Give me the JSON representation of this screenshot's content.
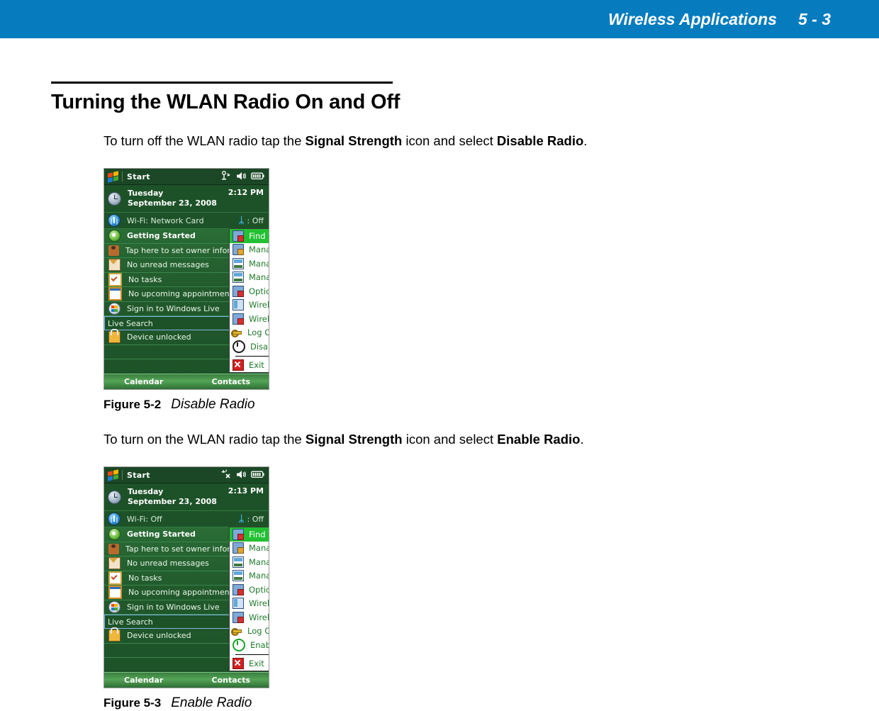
{
  "header": {
    "title": "Wireless Applications",
    "page_number": "5 - 3",
    "band_color": "#067cbf"
  },
  "section": {
    "heading": "Turning the WLAN Radio On and Off"
  },
  "paragraphs": {
    "p1": {
      "part1": "To turn off the WLAN radio tap the ",
      "bold1": "Signal Strength",
      "part2": " icon and select ",
      "bold2": "Disable Radio",
      "part3": "."
    },
    "p2": {
      "part1": "To turn on the WLAN radio tap the ",
      "bold1": "Signal Strength",
      "part2": " icon and select ",
      "bold2": "Enable Radio",
      "part3": "."
    }
  },
  "figures": [
    {
      "number": "Figure 5-2",
      "label": "Disable Radio"
    },
    {
      "number": "Figure 5-3",
      "label": "Enable Radio"
    }
  ],
  "screenshots": [
    {
      "titlebar": {
        "start_label": "Start",
        "icons": [
          "signal-strength-icon",
          "volume-icon",
          "battery-icon"
        ]
      },
      "clock": {
        "day": "Tuesday",
        "date": "September 23, 2008",
        "time": "2:12 PM"
      },
      "wifi": {
        "label": "Wi-Fi: Network Card",
        "bluetooth_label": ": Off"
      },
      "today_items": [
        {
          "label": "Getting Started",
          "icon": "getting-started-icon",
          "bold": true
        },
        {
          "label": "Tap here to set owner information",
          "icon": "owner-icon",
          "bold": false
        },
        {
          "label": "No unread messages",
          "icon": "mail-icon",
          "bold": false
        },
        {
          "label": "No tasks",
          "icon": "task-icon",
          "bold": false
        },
        {
          "label": "No upcoming appointments",
          "icon": "calendar-icon",
          "bold": false
        },
        {
          "label": "Sign in to Windows Live",
          "icon": "windows-live-icon",
          "bold": false
        },
        {
          "label": "Live Search",
          "icon": "search-box",
          "bold": false
        },
        {
          "label": "Device unlocked",
          "icon": "lock-icon",
          "bold": false
        }
      ],
      "menu": [
        {
          "label": "Find WLANs",
          "icon": "find-wlans-icon",
          "selected": true
        },
        {
          "label": "Manage Profiles",
          "icon": "manage-profiles-icon",
          "selected": false
        },
        {
          "label": "Manage Certs",
          "icon": "manage-certs-icon",
          "selected": false
        },
        {
          "label": "Manage PACs",
          "icon": "manage-pacs-icon",
          "selected": false
        },
        {
          "label": "Options",
          "icon": "options-icon",
          "selected": false
        },
        {
          "label": "Wireless Status",
          "icon": "wireless-status-icon",
          "selected": false
        },
        {
          "label": "Wireless Diagnostics",
          "icon": "wireless-diagnostics-icon",
          "selected": false
        },
        {
          "label": "Log On/Off",
          "icon": "key-icon",
          "selected": false
        },
        {
          "label": "Disable Radio",
          "icon": "power-icon",
          "selected": false
        },
        {
          "label": "Exit",
          "icon": "exit-icon",
          "selected": false
        }
      ],
      "softkeys": {
        "left": "Calendar",
        "right": "Contacts"
      }
    },
    {
      "titlebar": {
        "start_label": "Start",
        "icons": [
          "signal-off-icon",
          "volume-icon",
          "battery-icon"
        ]
      },
      "clock": {
        "day": "Tuesday",
        "date": "September 23, 2008",
        "time": "2:13 PM"
      },
      "wifi": {
        "label": "Wi-Fi: Off",
        "bluetooth_label": ": Off"
      },
      "today_items": [
        {
          "label": "Getting Started",
          "icon": "getting-started-icon",
          "bold": true
        },
        {
          "label": "Tap here to set owner information",
          "icon": "owner-icon",
          "bold": false
        },
        {
          "label": "No unread messages",
          "icon": "mail-icon",
          "bold": false
        },
        {
          "label": "No tasks",
          "icon": "task-icon",
          "bold": false
        },
        {
          "label": "No upcoming appointments",
          "icon": "calendar-icon",
          "bold": false
        },
        {
          "label": "Sign in to Windows Live",
          "icon": "windows-live-icon",
          "bold": false
        },
        {
          "label": "Live Search",
          "icon": "search-box",
          "bold": false
        },
        {
          "label": "Device unlocked",
          "icon": "lock-icon",
          "bold": false
        }
      ],
      "menu": [
        {
          "label": "Find WLANs",
          "icon": "find-wlans-icon",
          "selected": true
        },
        {
          "label": "Manage Profiles",
          "icon": "manage-profiles-icon",
          "selected": false
        },
        {
          "label": "Manage Certs",
          "icon": "manage-certs-icon",
          "selected": false
        },
        {
          "label": "Manage PACs",
          "icon": "manage-pacs-icon",
          "selected": false
        },
        {
          "label": "Options",
          "icon": "options-icon",
          "selected": false
        },
        {
          "label": "Wireless Status",
          "icon": "wireless-status-icon",
          "selected": false
        },
        {
          "label": "Wireless Diagnostics",
          "icon": "wireless-diagnostics-icon",
          "selected": false
        },
        {
          "label": "Log On/Off",
          "icon": "key-icon",
          "selected": false
        },
        {
          "label": "Enable Radio",
          "icon": "power-icon-green",
          "selected": false
        },
        {
          "label": "Exit",
          "icon": "exit-icon",
          "selected": false
        }
      ],
      "softkeys": {
        "left": "Calendar",
        "right": "Contacts"
      }
    }
  ]
}
